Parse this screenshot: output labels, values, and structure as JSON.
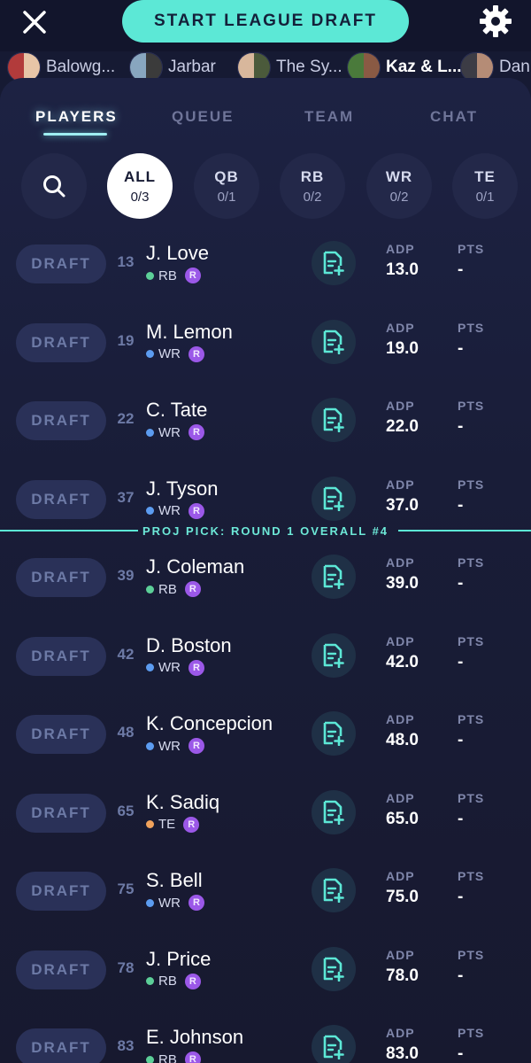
{
  "header": {
    "start_label": "START LEAGUE DRAFT",
    "icons": {
      "close": "close-icon",
      "settings": "gear-icon"
    }
  },
  "teams": [
    {
      "name": "Balowg...",
      "active": false,
      "colors": [
        "#b23b3b",
        "#e7c5a7"
      ]
    },
    {
      "name": "Jarbar",
      "active": false,
      "colors": [
        "#88a6bf",
        "#3b3b3b"
      ]
    },
    {
      "name": "The Sy...",
      "active": false,
      "colors": [
        "#d8b79c",
        "#4b5a3b"
      ]
    },
    {
      "name": "Kaz & L...",
      "active": true,
      "colors": [
        "#4a7a3b",
        "#8a5a44"
      ]
    },
    {
      "name": "Dan",
      "active": false,
      "colors": [
        "#3c3c45",
        "#b58c76"
      ]
    }
  ],
  "tabs": [
    "PLAYERS",
    "QUEUE",
    "TEAM",
    "CHAT"
  ],
  "filters": [
    {
      "icon": "search-icon"
    },
    {
      "pos": "ALL",
      "count": "0/3",
      "active": true
    },
    {
      "pos": "QB",
      "count": "0/1"
    },
    {
      "pos": "RB",
      "count": "0/2"
    },
    {
      "pos": "WR",
      "count": "0/2"
    },
    {
      "pos": "TE",
      "count": "0/1"
    }
  ],
  "labels": {
    "draft": "DRAFT",
    "adp": "ADP",
    "pts": "PTS",
    "rookie": "R"
  },
  "proj_pick": "PROJ PICK: ROUND 1 OVERALL #4",
  "colors": {
    "accent": "#5ce8d6",
    "RB": "#5ccf98",
    "WR": "#5c9cf0",
    "TE": "#f0a25c",
    "rookie": "#9b58e8"
  },
  "players": [
    {
      "rank": "13",
      "name": "J. Love",
      "pos": "RB",
      "adp": "13.0",
      "pts": "-"
    },
    {
      "rank": "19",
      "name": "M. Lemon",
      "pos": "WR",
      "adp": "19.0",
      "pts": "-"
    },
    {
      "rank": "22",
      "name": "C. Tate",
      "pos": "WR",
      "adp": "22.0",
      "pts": "-"
    },
    {
      "rank": "37",
      "name": "J. Tyson",
      "pos": "WR",
      "adp": "37.0",
      "pts": "-"
    },
    {
      "rank": "39",
      "name": "J. Coleman",
      "pos": "RB",
      "adp": "39.0",
      "pts": "-"
    },
    {
      "rank": "42",
      "name": "D. Boston",
      "pos": "WR",
      "adp": "42.0",
      "pts": "-"
    },
    {
      "rank": "48",
      "name": "K. Concepcion",
      "pos": "WR",
      "adp": "48.0",
      "pts": "-"
    },
    {
      "rank": "65",
      "name": "K. Sadiq",
      "pos": "TE",
      "adp": "65.0",
      "pts": "-"
    },
    {
      "rank": "75",
      "name": "S. Bell",
      "pos": "WR",
      "adp": "75.0",
      "pts": "-"
    },
    {
      "rank": "78",
      "name": "J. Price",
      "pos": "RB",
      "adp": "78.0",
      "pts": "-"
    },
    {
      "rank": "83",
      "name": "E. Johnson",
      "pos": "RB",
      "adp": "83.0",
      "pts": "-"
    }
  ]
}
